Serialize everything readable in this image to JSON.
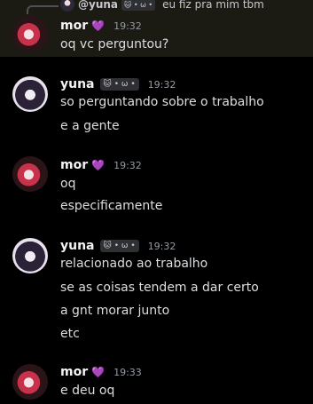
{
  "reply": {
    "username": "@yuna",
    "tag": "🐱 • ω •",
    "text": "eu fiz pra mim tbm"
  },
  "messages": [
    {
      "author": "mor",
      "heart": "💜",
      "tag": "",
      "time": "19:32",
      "lines": [
        "oq vc perguntou?"
      ]
    },
    {
      "author": "yuna",
      "heart": "",
      "tag": "🐱 • ω •",
      "time": "19:32",
      "lines": [
        "so perguntando sobre o trabalho",
        "e a gente"
      ]
    },
    {
      "author": "mor",
      "heart": "💜",
      "tag": "",
      "time": "19:32",
      "lines": [
        "oq",
        "especificamente"
      ]
    },
    {
      "author": "yuna",
      "heart": "",
      "tag": "🐱 • ω •",
      "time": "19:32",
      "lines": [
        "relacionado ao trabalho",
        "se as coisas tendem a dar certo",
        "a gnt morar junto",
        "etc"
      ]
    },
    {
      "author": "mor",
      "heart": "💜",
      "tag": "",
      "time": "19:33",
      "lines": [
        "e deu oq"
      ]
    }
  ]
}
